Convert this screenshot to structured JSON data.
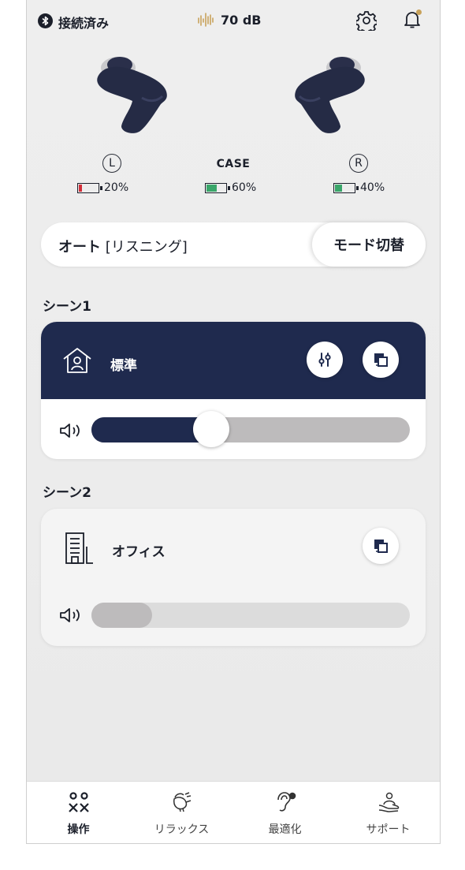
{
  "status": {
    "connection": "接続済み",
    "noise_level": "70 dB",
    "icons": [
      "bluetooth-icon",
      "sound-level-icon",
      "gear-icon",
      "bell-icon"
    ],
    "notification_dot_color": "#c8a25a"
  },
  "devices": {
    "left": {
      "symbol": "L",
      "battery": "20%",
      "battery_level": 0.2,
      "color": "#d32f3a"
    },
    "case": {
      "label": "CASE",
      "battery": "60%",
      "battery_level": 0.6,
      "color": "#3aa66a"
    },
    "right": {
      "symbol": "R",
      "battery": "40%",
      "battery_level": 0.4,
      "color": "#3aa66a"
    }
  },
  "mode": {
    "name": "オート",
    "sub": "[リスニング]",
    "switch_label": "モード切替"
  },
  "scenes": [
    {
      "title": "シーン1",
      "name": "標準",
      "icon": "home-icon",
      "volume_level": 0.34,
      "active": true,
      "header_color": "#1f2a4e"
    },
    {
      "title": "シーン2",
      "name": "オフィス",
      "icon": "building-icon",
      "volume_level": 0.19,
      "active": false
    }
  ],
  "nav": [
    {
      "label": "操作",
      "icon": "control-icon",
      "active": true
    },
    {
      "label": "リラックス",
      "icon": "bird-icon",
      "active": false
    },
    {
      "label": "最適化",
      "icon": "ear-icon",
      "active": false
    },
    {
      "label": "サポート",
      "icon": "support-icon",
      "active": false
    }
  ]
}
